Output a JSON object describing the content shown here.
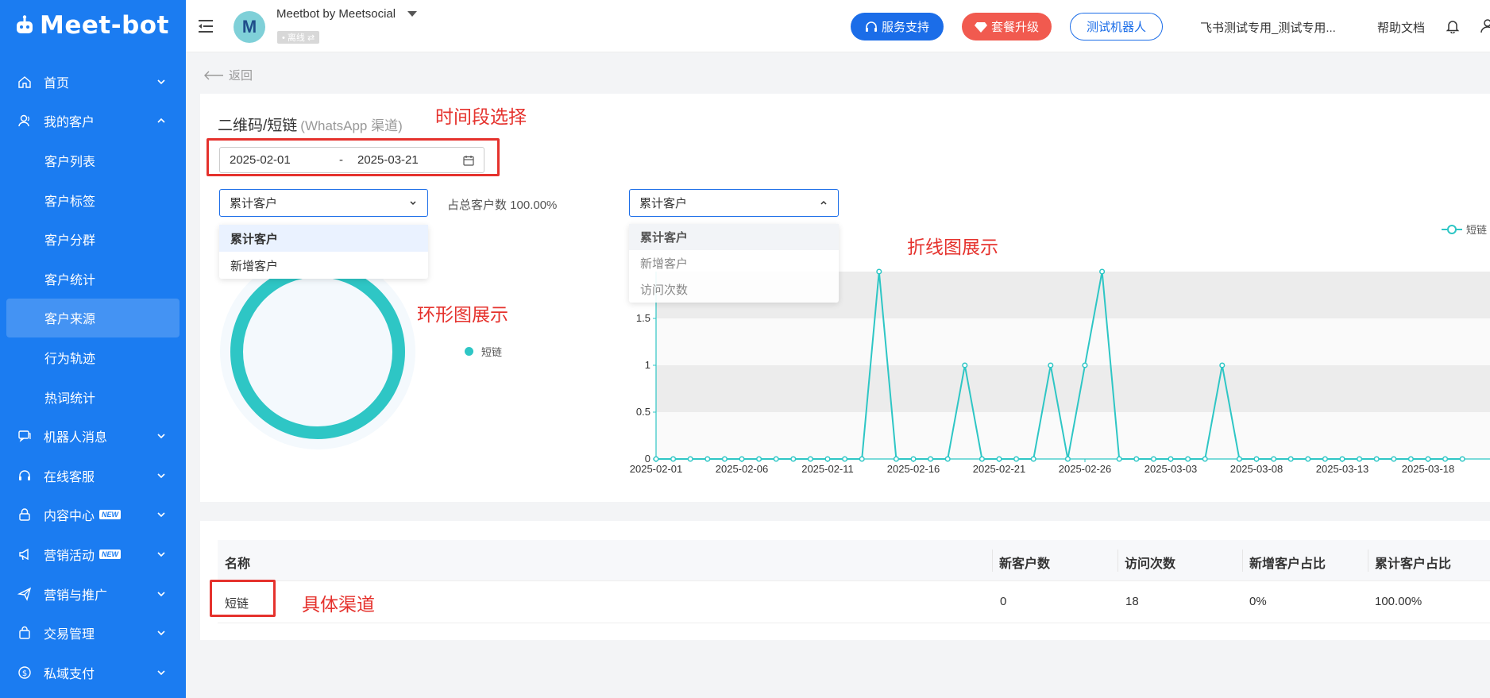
{
  "sidebar": {
    "logo": "Meet-bot",
    "items": [
      {
        "label": "首页",
        "icon": "home-icon",
        "expanded": false
      },
      {
        "label": "我的客户",
        "icon": "user-icon",
        "expanded": true,
        "children": [
          "客户列表",
          "客户标签",
          "客户分群",
          "客户统计",
          "客户来源",
          "行为轨迹",
          "热词统计"
        ],
        "active_child": "客户来源"
      },
      {
        "label": "机器人消息",
        "icon": "chat-icon",
        "expanded": false
      },
      {
        "label": "在线客服",
        "icon": "headset-icon",
        "expanded": false
      },
      {
        "label": "内容中心",
        "icon": "lock-icon",
        "expanded": false,
        "badge": "NEW"
      },
      {
        "label": "营销活动",
        "icon": "megaphone-icon",
        "expanded": false,
        "badge": "NEW"
      },
      {
        "label": "营销与推广",
        "icon": "send-icon",
        "expanded": false
      },
      {
        "label": "交易管理",
        "icon": "bag-icon",
        "expanded": false
      },
      {
        "label": "私域支付",
        "icon": "coin-icon",
        "expanded": false
      }
    ]
  },
  "header": {
    "avatar_letter": "M",
    "account_name": "Meetbot by Meetsocial",
    "status": "• 离线  ⇄",
    "support_btn": "服务支持",
    "upgrade_btn": "套餐升级",
    "test_btn": "测试机器人",
    "workspace": "飞书测试专用_测试专用...",
    "help": "帮助文档"
  },
  "page": {
    "back": "返回",
    "title": "二维码/短链",
    "subtitle": "(WhatsApp 渠道)",
    "date_start": "2025-02-01",
    "date_sep": "-",
    "date_end": "2025-03-21",
    "left_select": "累计客户",
    "left_options": [
      "累计客户",
      "新增客户"
    ],
    "ratio_text": "占总客户数 100.00%",
    "right_select": "累计客户",
    "right_options": [
      "累计客户",
      "新增客户",
      "访问次数"
    ],
    "donut_legend": "短链",
    "line_legend": "短链"
  },
  "annotations": {
    "time_select": "时间段选择",
    "donut": "环形图展示",
    "line": "折线图展示",
    "channel": "具体渠道"
  },
  "table": {
    "headers": [
      "名称",
      "新客户数",
      "访问次数",
      "新增客户占比",
      "累计客户占比"
    ],
    "rows": [
      [
        "短链",
        "0",
        "18",
        "0%",
        "100.00%"
      ]
    ]
  },
  "colors": {
    "sidebar": "#1b7cf1",
    "accent": "#1b6de8",
    "upgrade": "#f15a4f",
    "series": "#2ec6c5",
    "annotation": "#e5322d"
  },
  "chart_data": [
    {
      "type": "pie",
      "variant": "donut",
      "labels": [
        "短链"
      ],
      "values": [
        100
      ]
    },
    {
      "type": "line",
      "title": "",
      "xlabel": "",
      "ylabel": "",
      "x": [
        "2025-02-01",
        "2025-02-02",
        "2025-02-03",
        "2025-02-04",
        "2025-02-05",
        "2025-02-06",
        "2025-02-07",
        "2025-02-08",
        "2025-02-09",
        "2025-02-10",
        "2025-02-11",
        "2025-02-12",
        "2025-02-13",
        "2025-02-14",
        "2025-02-15",
        "2025-02-16",
        "2025-02-17",
        "2025-02-18",
        "2025-02-19",
        "2025-02-20",
        "2025-02-21",
        "2025-02-22",
        "2025-02-23",
        "2025-02-24",
        "2025-02-25",
        "2025-02-26",
        "2025-02-27",
        "2025-02-28",
        "2025-03-01",
        "2025-03-02",
        "2025-03-03",
        "2025-03-04",
        "2025-03-05",
        "2025-03-06",
        "2025-03-07",
        "2025-03-08",
        "2025-03-09",
        "2025-03-10",
        "2025-03-11",
        "2025-03-12",
        "2025-03-13",
        "2025-03-14",
        "2025-03-15",
        "2025-03-16",
        "2025-03-17",
        "2025-03-18",
        "2025-03-19",
        "2025-03-20"
      ],
      "x_tick_labels": [
        "2025-02-01",
        "2025-02-06",
        "2025-02-11",
        "2025-02-16",
        "2025-02-21",
        "2025-02-26",
        "2025-03-03",
        "2025-03-08",
        "2025-03-13",
        "2025-03-18"
      ],
      "y_ticks": [
        0,
        0.5,
        1,
        1.5
      ],
      "ylim": [
        0,
        2
      ],
      "series": [
        {
          "name": "短链",
          "values": [
            0,
            0,
            0,
            0,
            0,
            0,
            0,
            0,
            0,
            0,
            0,
            0,
            0,
            2,
            0,
            0,
            0,
            0,
            1,
            0,
            0,
            0,
            0,
            1,
            0,
            1,
            2,
            0,
            0,
            0,
            0,
            0,
            0,
            1,
            0,
            0,
            0,
            0,
            0,
            0,
            0,
            0,
            0,
            0,
            0,
            0,
            0,
            0
          ]
        }
      ],
      "grid": true,
      "legend": "top-right"
    }
  ]
}
